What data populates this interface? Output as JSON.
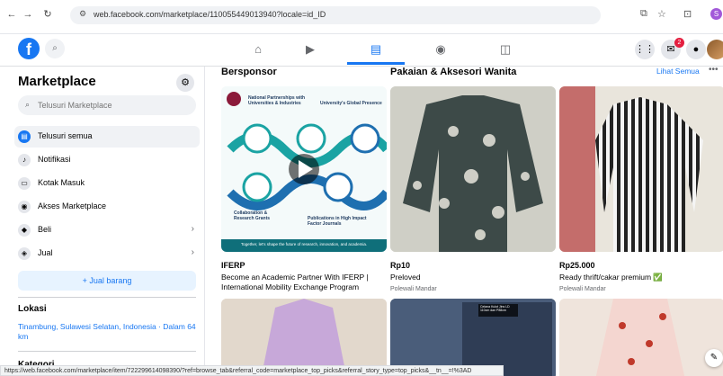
{
  "browser": {
    "url": "web.facebook.com/marketplace/110055449013940?locale=id_ID",
    "profile_letter": "S"
  },
  "topbar": {
    "logo": "f",
    "notif_count": "2"
  },
  "sidebar": {
    "title": "Marketplace",
    "search_placeholder": "Telusuri Marketplace",
    "items": [
      {
        "label": "Telusuri semua",
        "icon": "storefront-icon",
        "active": true
      },
      {
        "label": "Notifikasi",
        "icon": "bell-icon"
      },
      {
        "label": "Kotak Masuk",
        "icon": "inbox-icon"
      },
      {
        "label": "Akses Marketplace",
        "icon": "badge-icon"
      },
      {
        "label": "Beli",
        "icon": "shopping-bag-icon"
      },
      {
        "label": "Jual",
        "icon": "tag-icon"
      }
    ],
    "sell_button": "+ Jual barang",
    "location_heading": "Lokasi",
    "location": "Tinambung, Sulawesi Selatan, Indonesia · Dalam 64 km",
    "category_heading": "Kategori"
  },
  "main": {
    "sponsored_heading": "Bersponsor",
    "section_heading": "Pakaian & Aksesori Wanita",
    "see_all": "Lihat Semua",
    "ad": {
      "brand": "IFERP",
      "text": "Become an Academic Partner With IFERP | International Mobility Exchange Program",
      "img_top": "National Partnerships with Universities & Industries",
      "img_right": "University's Global Presence",
      "img_left": "Collaboration & Research Grants",
      "img_bottom": "Publications in High Impact Factor Journals",
      "img_footer": "Together, let's shape the future of research, innovation, and academia."
    },
    "listings": [
      {
        "price": "Rp10",
        "title": "Preloved",
        "location": "Polewali Mandar"
      },
      {
        "price": "Rp25.000",
        "title": "Ready thrift/cakar premium ✅",
        "location": "Polewali Mandar"
      }
    ],
    "row2_label": "Celana Kulot Jins LD 110cm dan P88cm"
  },
  "status_url": "https://web.facebook.com/marketplace/item/722299614098390/?ref=browse_tab&referral_code=marketplace_top_picks&referral_story_type=top_picks&__tn__=!%3AD"
}
